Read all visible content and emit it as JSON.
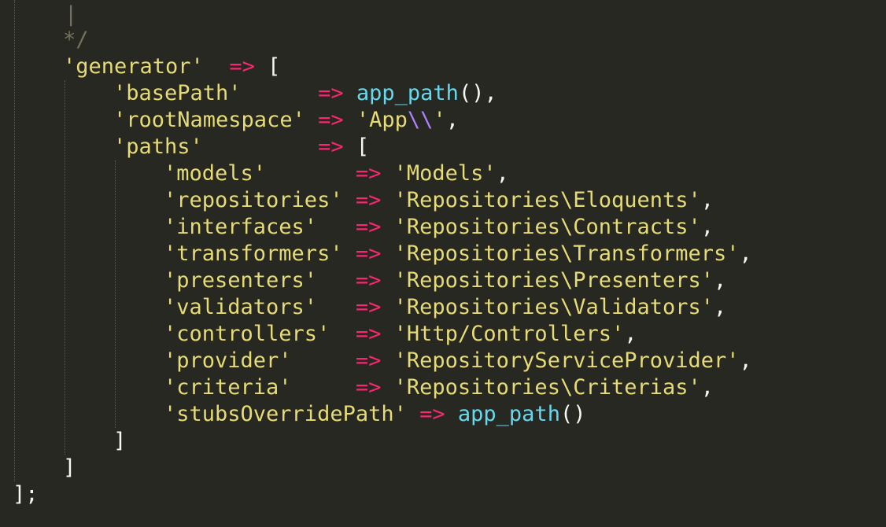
{
  "editor": {
    "theme_colors": {
      "background": "#272822",
      "comment": "#75715e",
      "string": "#e6db74",
      "operator": "#f92672",
      "function": "#66d9ef",
      "escape": "#ae81ff",
      "plain": "#f8f8f2"
    },
    "lines": [
      {
        "tokens": [
          {
            "t": "|",
            "c": "comment"
          }
        ]
      },
      {
        "tokens": [
          {
            "t": "*/",
            "c": "comment"
          }
        ]
      },
      {
        "tokens": [
          {
            "t": "'generator'",
            "c": "string"
          },
          {
            "t": "  ",
            "c": "punct"
          },
          {
            "t": "=>",
            "c": "op"
          },
          {
            "t": " [",
            "c": "punct"
          }
        ]
      },
      {
        "tokens": [
          {
            "t": "'basePath'",
            "c": "string"
          },
          {
            "t": "      ",
            "c": "punct"
          },
          {
            "t": "=>",
            "c": "op"
          },
          {
            "t": " ",
            "c": "punct"
          },
          {
            "t": "app_path",
            "c": "func"
          },
          {
            "t": "(),",
            "c": "punct"
          }
        ]
      },
      {
        "tokens": [
          {
            "t": "'rootNamespace'",
            "c": "string"
          },
          {
            "t": " ",
            "c": "punct"
          },
          {
            "t": "=>",
            "c": "op"
          },
          {
            "t": " ",
            "c": "punct"
          },
          {
            "t": "'App",
            "c": "string"
          },
          {
            "t": "\\\\",
            "c": "escape"
          },
          {
            "t": "'",
            "c": "string"
          },
          {
            "t": ",",
            "c": "punct"
          }
        ]
      },
      {
        "tokens": [
          {
            "t": "'paths'",
            "c": "string"
          },
          {
            "t": "         ",
            "c": "punct"
          },
          {
            "t": "=>",
            "c": "op"
          },
          {
            "t": " [",
            "c": "punct"
          }
        ]
      },
      {
        "tokens": [
          {
            "t": "'models'",
            "c": "string"
          },
          {
            "t": "       ",
            "c": "punct"
          },
          {
            "t": "=>",
            "c": "op"
          },
          {
            "t": " ",
            "c": "punct"
          },
          {
            "t": "'Models'",
            "c": "string"
          },
          {
            "t": ",",
            "c": "punct"
          }
        ]
      },
      {
        "tokens": [
          {
            "t": "'repositories'",
            "c": "string"
          },
          {
            "t": " ",
            "c": "punct"
          },
          {
            "t": "=>",
            "c": "op"
          },
          {
            "t": " ",
            "c": "punct"
          },
          {
            "t": "'Repositories\\Eloquents'",
            "c": "string"
          },
          {
            "t": ",",
            "c": "punct"
          }
        ]
      },
      {
        "tokens": [
          {
            "t": "'interfaces'",
            "c": "string"
          },
          {
            "t": "   ",
            "c": "punct"
          },
          {
            "t": "=>",
            "c": "op"
          },
          {
            "t": " ",
            "c": "punct"
          },
          {
            "t": "'Repositories\\Contracts'",
            "c": "string"
          },
          {
            "t": ",",
            "c": "punct"
          }
        ]
      },
      {
        "tokens": [
          {
            "t": "'transformers'",
            "c": "string"
          },
          {
            "t": " ",
            "c": "punct"
          },
          {
            "t": "=>",
            "c": "op"
          },
          {
            "t": " ",
            "c": "punct"
          },
          {
            "t": "'Repositories\\Transformers'",
            "c": "string"
          },
          {
            "t": ",",
            "c": "punct"
          }
        ]
      },
      {
        "tokens": [
          {
            "t": "'presenters'",
            "c": "string"
          },
          {
            "t": "   ",
            "c": "punct"
          },
          {
            "t": "=>",
            "c": "op"
          },
          {
            "t": " ",
            "c": "punct"
          },
          {
            "t": "'Repositories\\Presenters'",
            "c": "string"
          },
          {
            "t": ",",
            "c": "punct"
          }
        ]
      },
      {
        "tokens": [
          {
            "t": "'validators'",
            "c": "string"
          },
          {
            "t": "   ",
            "c": "punct"
          },
          {
            "t": "=>",
            "c": "op"
          },
          {
            "t": " ",
            "c": "punct"
          },
          {
            "t": "'Repositories\\Validators'",
            "c": "string"
          },
          {
            "t": ",",
            "c": "punct"
          }
        ]
      },
      {
        "tokens": [
          {
            "t": "'controllers'",
            "c": "string"
          },
          {
            "t": "  ",
            "c": "punct"
          },
          {
            "t": "=>",
            "c": "op"
          },
          {
            "t": " ",
            "c": "punct"
          },
          {
            "t": "'Http/Controllers'",
            "c": "string"
          },
          {
            "t": ",",
            "c": "punct"
          }
        ]
      },
      {
        "tokens": [
          {
            "t": "'provider'",
            "c": "string"
          },
          {
            "t": "     ",
            "c": "punct"
          },
          {
            "t": "=>",
            "c": "op"
          },
          {
            "t": " ",
            "c": "punct"
          },
          {
            "t": "'RepositoryServiceProvider'",
            "c": "string"
          },
          {
            "t": ",",
            "c": "punct"
          }
        ]
      },
      {
        "tokens": [
          {
            "t": "'criteria'",
            "c": "string"
          },
          {
            "t": "     ",
            "c": "punct"
          },
          {
            "t": "=>",
            "c": "op"
          },
          {
            "t": " ",
            "c": "punct"
          },
          {
            "t": "'Repositories\\Criterias'",
            "c": "string"
          },
          {
            "t": ",",
            "c": "punct"
          }
        ]
      },
      {
        "tokens": [
          {
            "t": "'stubsOverridePath'",
            "c": "string"
          },
          {
            "t": " ",
            "c": "punct"
          },
          {
            "t": "=>",
            "c": "op"
          },
          {
            "t": " ",
            "c": "punct"
          },
          {
            "t": "app_path",
            "c": "func"
          },
          {
            "t": "()",
            "c": "punct"
          }
        ]
      },
      {
        "tokens": [
          {
            "t": "]",
            "c": "punct"
          }
        ]
      },
      {
        "tokens": [
          {
            "t": "]",
            "c": "punct"
          }
        ]
      },
      {
        "tokens": [
          {
            "t": "];",
            "c": "punct"
          }
        ]
      }
    ]
  }
}
